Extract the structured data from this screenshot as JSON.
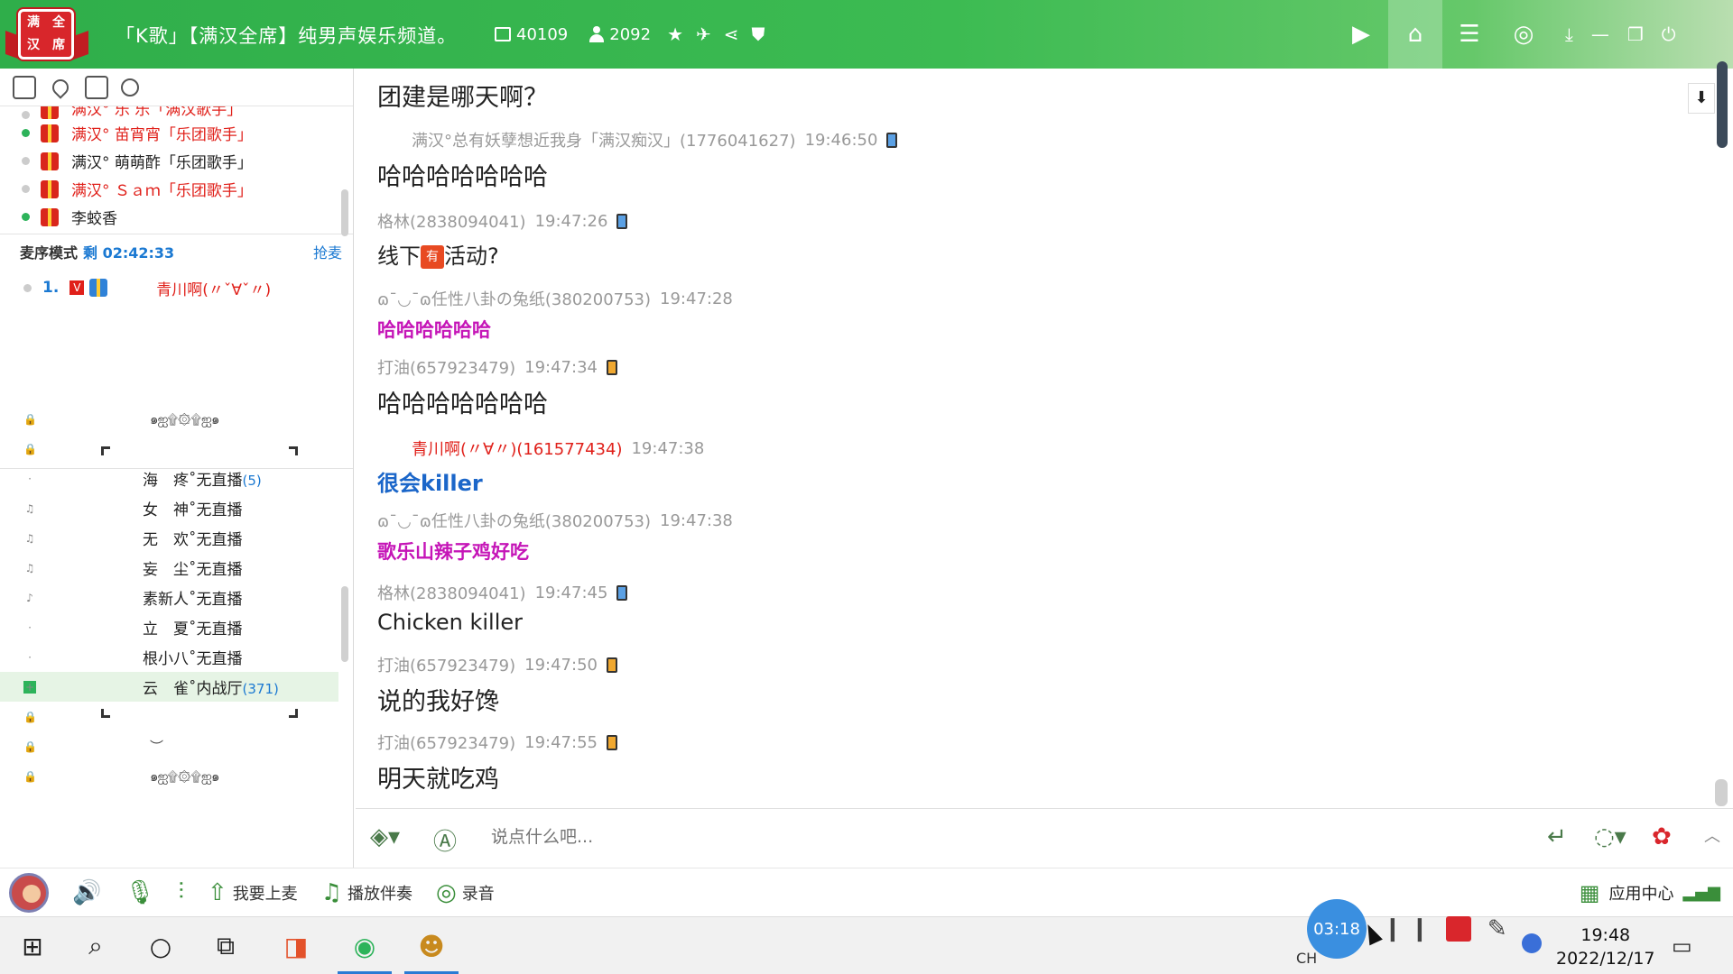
{
  "window": {
    "logo_chars": [
      "满",
      "全",
      "汉",
      "席"
    ],
    "title": "「K歌」【满汉全席】纯男声娱乐频道。",
    "room_id": "40109",
    "online_count": "2092",
    "accent_color": "#3cbb52"
  },
  "left_toolbar": [
    "person-icon",
    "location-icon",
    "notes-icon",
    "search-icon"
  ],
  "users": [
    {
      "name": "满汉° 乐 乐「满汉歌手」",
      "color": "red",
      "online": false,
      "partial": true
    },
    {
      "name": "满汉° 苗宵宵「乐团歌手」",
      "color": "red",
      "online": true
    },
    {
      "name": "满汉° 萌萌酢「乐团歌手」",
      "color": "black",
      "online": false
    },
    {
      "name": "满汉° Ｓａｍ「乐团歌手」",
      "color": "red",
      "online": false
    },
    {
      "name": "李蛟香",
      "color": "black",
      "online": true
    }
  ],
  "mic_order": {
    "label": "麦序模式",
    "timer": "剩 02:42:33",
    "grab": "抢麦"
  },
  "queue": [
    {
      "num": "1.",
      "badge": "V",
      "name": "青川啊(〃ˇ∀ˇ〃)"
    }
  ],
  "rooms": [
    {
      "type": "deco",
      "text": "๑ஐ۩۞۩ஐ๑"
    },
    {
      "type": "corner-top"
    },
    {
      "type": "room",
      "icon": "·",
      "name": "海　疼˚无直播",
      "count": "(5)"
    },
    {
      "type": "room",
      "icon": "♫",
      "name": "女　神˚无直播"
    },
    {
      "type": "room",
      "icon": "♫",
      "name": "无　欢˚无直播"
    },
    {
      "type": "room",
      "icon": "♫",
      "name": "妄　尘˚无直播"
    },
    {
      "type": "room",
      "icon": "♪",
      "name": "素新人˚无直播"
    },
    {
      "type": "room",
      "icon": "·",
      "name": "立　夏˚无直播"
    },
    {
      "type": "room",
      "icon": "·",
      "name": "根小八˚无直播"
    },
    {
      "type": "room",
      "icon": "+",
      "name": "云　雀˚内战厅",
      "count": "(371)",
      "selected": true
    },
    {
      "type": "corner-bottom"
    },
    {
      "type": "deco",
      "text": "︶"
    },
    {
      "type": "deco",
      "text": "๑ஐ۩۞۩ஐ๑"
    }
  ],
  "messages": [
    {
      "meta": "",
      "time": "",
      "body": "团建是哪天啊？",
      "style": "normal"
    },
    {
      "meta": "满汉°总有妖孽想近我身「满汉痴汉」(1776041627)",
      "time": "19:46:50",
      "body": "哈哈哈哈哈哈哈",
      "style": "normal",
      "icon": "blue",
      "indent": true
    },
    {
      "meta": "格林(2838094041)",
      "time": "19:47:26",
      "body_pre": "线下",
      "emoji": "有",
      "body": "活动?",
      "style": "small",
      "icon": "blue"
    },
    {
      "meta": "ɷ¯◡¯ɷ任性八卦の兔纸(380200753)",
      "time": "19:47:28",
      "body": "哈哈哈哈哈哈",
      "style": "pink"
    },
    {
      "meta": "打油(657923479)",
      "time": "19:47:34",
      "body": "哈哈哈哈哈哈哈",
      "style": "normal",
      "icon": "orange"
    },
    {
      "meta": "青川啊(〃∀〃)(161577434)",
      "time": "19:47:38",
      "body": "很会killer",
      "style": "blue",
      "metaRed": true,
      "indent": true
    },
    {
      "meta": "ɷ¯◡¯ɷ任性八卦の兔纸(380200753)",
      "time": "19:47:38",
      "body": "歌乐山辣子鸡好吃",
      "style": "pink"
    },
    {
      "meta": "格林(2838094041)",
      "time": "19:47:45",
      "body": "Chicken killer",
      "style": "small",
      "icon": "blue"
    },
    {
      "meta": "打油(657923479)",
      "time": "19:47:50",
      "body": "说的我好馋",
      "style": "normal",
      "icon": "orange"
    },
    {
      "meta": "打油(657923479)",
      "time": "19:47:55",
      "body": "明天就吃鸡",
      "style": "normal",
      "icon": "orange"
    }
  ],
  "input": {
    "placeholder": "说点什么吧..."
  },
  "bottom_bar": {
    "go_on_mic": "我要上麦",
    "play_accompaniment": "播放伴奏",
    "record": "录音",
    "app_center": "应用中心"
  },
  "recorder": {
    "time": "03:18"
  },
  "clock": {
    "time": "19:48",
    "date": "2022/12/17"
  },
  "taskbar_ime": "CH"
}
